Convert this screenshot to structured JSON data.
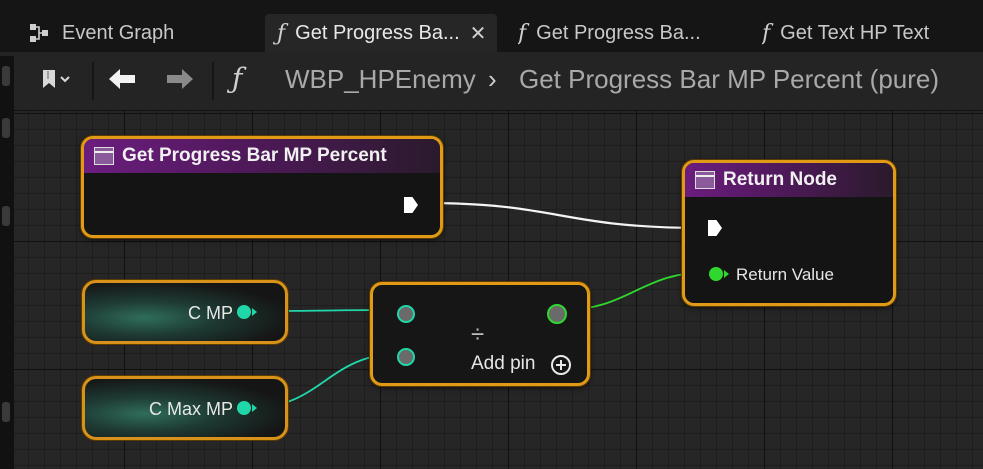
{
  "tabs": [
    {
      "label": "Event Graph",
      "icon": "event-graph-icon",
      "active": false
    },
    {
      "label": "Get Progress Ba...",
      "icon": "function-icon",
      "active": true
    },
    {
      "label": "Get Progress Ba...",
      "icon": "function-icon",
      "active": false
    },
    {
      "label": "Get Text HP Text",
      "icon": "function-icon",
      "active": false
    }
  ],
  "toolbar": {
    "bookmark_icon": "bookmark-icon",
    "back_icon": "arrow-left-icon",
    "forward_icon": "arrow-right-icon",
    "breadcrumb_root": "WBP_HPEnemy",
    "breadcrumb_separator": "›",
    "breadcrumb_current": "Get Progress Bar MP Percent (pure)"
  },
  "nodes": {
    "entry": {
      "title": "Get Progress Bar MP Percent"
    },
    "return": {
      "title": "Return Node",
      "pin_label": "Return Value"
    },
    "var_mp": {
      "label": "C MP"
    },
    "var_max_mp": {
      "label": "C Max MP"
    },
    "divide": {
      "symbol": "÷",
      "add_pin_label": "Add pin",
      "add_pin_icon": "plus-circle-icon"
    }
  },
  "colors": {
    "node_border": "#e19a16",
    "function_header": "#6b1d7e",
    "float_pin": "#1fd7a8",
    "bool_pin": "#2ed82e",
    "exec_wire": "#ffffff"
  }
}
